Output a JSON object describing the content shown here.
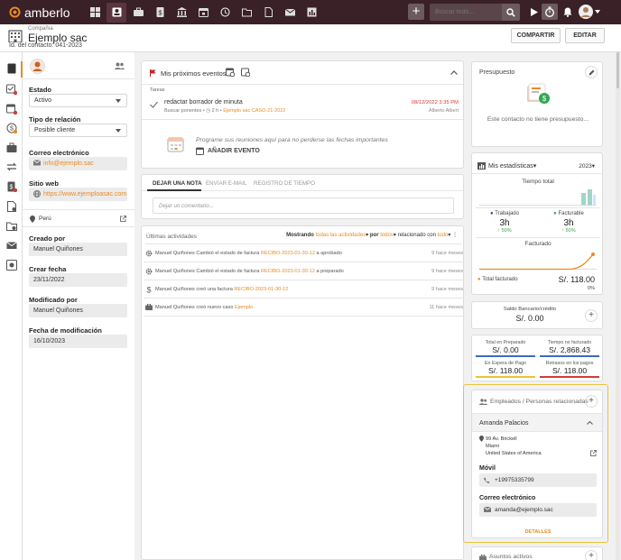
{
  "app": {
    "logo_text": "amberlo",
    "search_placeholder": "Buscar todo..."
  },
  "header": {
    "company_label": "Compañía",
    "title": "Ejemplo sac",
    "contact_id": "Id. del contacto: 041-2023",
    "share_btn": "COMPARTIR",
    "edit_btn": "EDITAR"
  },
  "left": {
    "estado_label": "Estado",
    "estado_value": "Activo",
    "relacion_label": "Tipo de relación",
    "relacion_value": "Posible cliente",
    "email_label": "Correo electrónico",
    "email_value": "info@ejemplo.sac",
    "web_label": "Sitio web",
    "web_value": "https://www.ejemploasac.com",
    "country": "Perú",
    "creado_label": "Creado por",
    "creado_value": "Manuel Quiñones",
    "crear_fecha_label": "Crear fecha",
    "crear_fecha_value": "23/11/2022",
    "modificado_label": "Modificado por",
    "modificado_value": "Manuel Quiñones",
    "fecha_mod_label": "Fecha de modificación",
    "fecha_mod_value": "16/10/2023"
  },
  "events": {
    "title": "Mis próximos eventos",
    "tasks_label": "Tareas",
    "task_title": "redactar borrador de minuta",
    "task_sub_prefix": "Buscar ponentes",
    "task_hours": "2 h",
    "task_link1": "Ejemplo sac",
    "task_link2": "CASO-21-2022",
    "task_date": "08/12/2022 3:35 PM",
    "task_person": "Alberto Albert",
    "empty_text": "Programe sus reuniones aquí para no perderse las fechas importantes",
    "add_event": "AÑADIR EVENTO"
  },
  "notes": {
    "tabs": [
      "DEJAR UNA NOTA",
      "ENVIAR E-MAIL",
      "REGISTRO DE TIEMPO"
    ],
    "placeholder": "Dejar un comentario..."
  },
  "activity": {
    "title": "Últimas actividades",
    "filter_prefix": "Mostrando",
    "filter_all": "todas las actividades",
    "filter_por": "por",
    "filter_todos": "todos",
    "filter_rel": "relacionado con",
    "filter_todo": "todo",
    "rows": [
      {
        "pre": "Manuel Quiñones Cambió el estado de factura",
        "link": "RECIBO-2023-01-30-12",
        "post": "a aprobado",
        "time": "9 hace meses",
        "icon": "gear-icon"
      },
      {
        "pre": "Manuel Quiñones Cambió el estado de factura",
        "link": "RECIBO-2023-01-30-12",
        "post": "a preparado",
        "time": "9 hace meses",
        "icon": "gear-icon"
      },
      {
        "pre": "Manuel Quiñones creó una factura",
        "link": "RECIBO-2023-01-30-12",
        "post": "",
        "time": "9 hace meses",
        "icon": "dollar-icon"
      },
      {
        "pre": "Manuel Quiñones creó nuevo caso",
        "link": "Ejemplo",
        "post": "",
        "time": "11 hace meses",
        "icon": "briefcase-icon"
      }
    ]
  },
  "budget": {
    "title": "Presupuesto",
    "empty": "Este contacto no tiene presupuesto..."
  },
  "stats": {
    "title": "Mis estadísticas",
    "year": "2023",
    "total_time": "Tiempo total",
    "worked_label": "Trabajado",
    "worked_value": "3h",
    "worked_pct": "50%",
    "billable_label": "Facturable",
    "billable_value": "3h",
    "billable_pct": "50%",
    "invoiced_title": "Facturado",
    "total_invoiced_label": "Total facturado",
    "total_invoiced_value": "S/. 118.00",
    "total_invoiced_pct": "0%"
  },
  "balance": {
    "label": "Saldo Bancario/crédito",
    "value": "S/. 0.00"
  },
  "totals": [
    {
      "label": "Total en Preparado",
      "value": "S/. 0.00",
      "color": "#3d6bc4"
    },
    {
      "label": "Tiempo no facturado",
      "value": "S/. 2,868.43",
      "color": "#3d6bc4"
    },
    {
      "label": "En Espera de Pago",
      "value": "S/. 118.00",
      "color": "#e9c23a"
    },
    {
      "label": "Retrasos en los pagos",
      "value": "S/. 118.00",
      "color": "#d33a3a"
    }
  ],
  "employees": {
    "title": "Empleados / Personas relacionadas",
    "person": "Amanda Palacios",
    "address_line1": "99 Av. Brickell",
    "address_line2": "Miami",
    "address_line3": "United States of America",
    "mobile_label": "Móvil",
    "mobile_value": "+19975335799",
    "email_label": "Correo electrónico",
    "email_value": "amanda@ejemplo.sac",
    "details": "DETALLES"
  },
  "cases": {
    "title": "Asuntos activos"
  },
  "colors": {
    "topbar": "#3a2027",
    "accent": "#e98b24",
    "highlight": "#e8c53a",
    "green": "#2fa84f"
  }
}
